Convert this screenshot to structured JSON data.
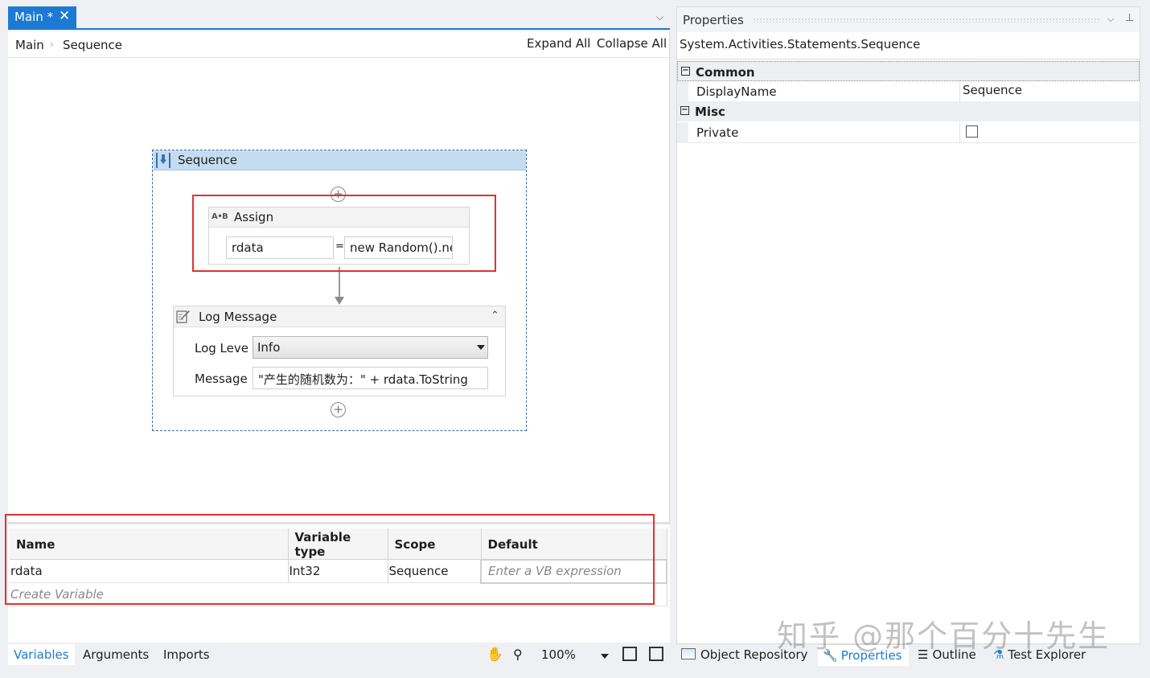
{
  "tab": {
    "label": "Main *",
    "close": "✕",
    "dropdown": "⌵"
  },
  "breadcrumb": {
    "items": [
      "Main",
      "Sequence"
    ],
    "separator": "›"
  },
  "toolbar": {
    "expand_all": "Expand All",
    "collapse_all": "Collapse All"
  },
  "sequence": {
    "title": "Sequence",
    "plus": "+",
    "assign": {
      "title": "Assign",
      "icon_text": "A•B",
      "to": "rdata",
      "equals": "=",
      "value": "new Random().ne"
    },
    "log_message": {
      "title": "Log Message",
      "collapse": "⌃",
      "level_label": "Log Leve",
      "level_value": "Info",
      "message_label": "Message",
      "message_value": "\"产生的随机数为：\" + rdata.ToString"
    }
  },
  "variables": {
    "columns": [
      "Name",
      "Variable type",
      "Scope",
      "Default"
    ],
    "rows": [
      {
        "name": "rdata",
        "type": "Int32",
        "scope": "Sequence",
        "default": "Enter a VB expression"
      }
    ],
    "create": "Create Variable"
  },
  "bottom_tabs": {
    "variables": "Variables",
    "arguments": "Arguments",
    "imports": "Imports"
  },
  "zoom": {
    "level": "100%",
    "hand_icon": "✋",
    "search_icon": "⚲"
  },
  "properties": {
    "title": "Properties",
    "type": "System.Activities.Statements.Sequence",
    "categories": {
      "common": {
        "label": "Common",
        "toggle": "−"
      },
      "misc": {
        "label": "Misc",
        "toggle": "−"
      }
    },
    "display_name": {
      "label": "DisplayName",
      "value": "Sequence"
    },
    "private": {
      "label": "Private",
      "checked": false
    },
    "dropdown": "⌵",
    "pin": "⊥"
  },
  "props_tabs": {
    "object_repository": "Object Repository",
    "properties": "Properties",
    "outline": "Outline",
    "test_explorer": "Test Explorer"
  },
  "watermark": "知乎 @那个百分十先生",
  "colors": {
    "accent": "#1c7ad4",
    "highlight": "#e03232",
    "sequence_header": "#c5dcf0"
  }
}
